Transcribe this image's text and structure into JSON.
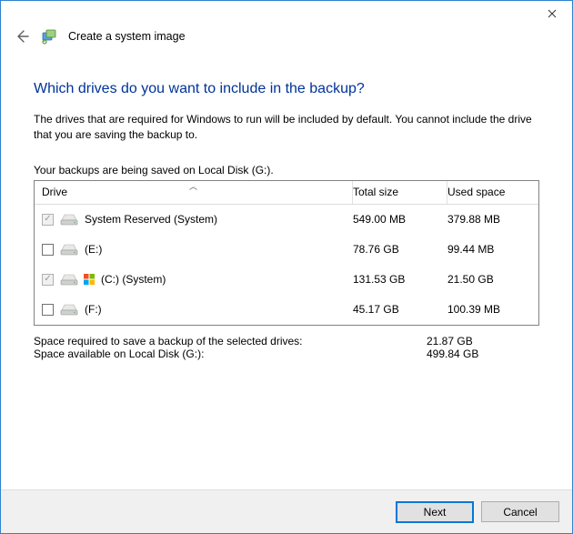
{
  "header": {
    "title": "Create a system image"
  },
  "main": {
    "heading": "Which drives do you want to include in the backup?",
    "description": "The drives that are required for Windows to run will be included by default. You cannot include the drive that you are saving the backup to.",
    "saving_location": "Your backups are being saved on Local Disk (G:)."
  },
  "table": {
    "columns": {
      "drive": "Drive",
      "total": "Total size",
      "used": "Used space"
    },
    "rows": [
      {
        "checked": true,
        "disabled": true,
        "windows": false,
        "label": "System Reserved (System)",
        "total": "549.00 MB",
        "used": "379.88 MB"
      },
      {
        "checked": false,
        "disabled": false,
        "windows": false,
        "label": "(E:)",
        "total": "78.76 GB",
        "used": "99.44 MB"
      },
      {
        "checked": true,
        "disabled": true,
        "windows": true,
        "label": "(C:) (System)",
        "total": "131.53 GB",
        "used": "21.50 GB"
      },
      {
        "checked": false,
        "disabled": false,
        "windows": false,
        "label": "(F:)",
        "total": "45.17 GB",
        "used": "100.39 MB"
      }
    ]
  },
  "summary": {
    "required_label": "Space required to save a backup of the selected drives:",
    "required_value": "21.87 GB",
    "available_label": "Space available on Local Disk (G:):",
    "available_value": "499.84 GB"
  },
  "footer": {
    "next": "Next",
    "cancel": "Cancel"
  }
}
